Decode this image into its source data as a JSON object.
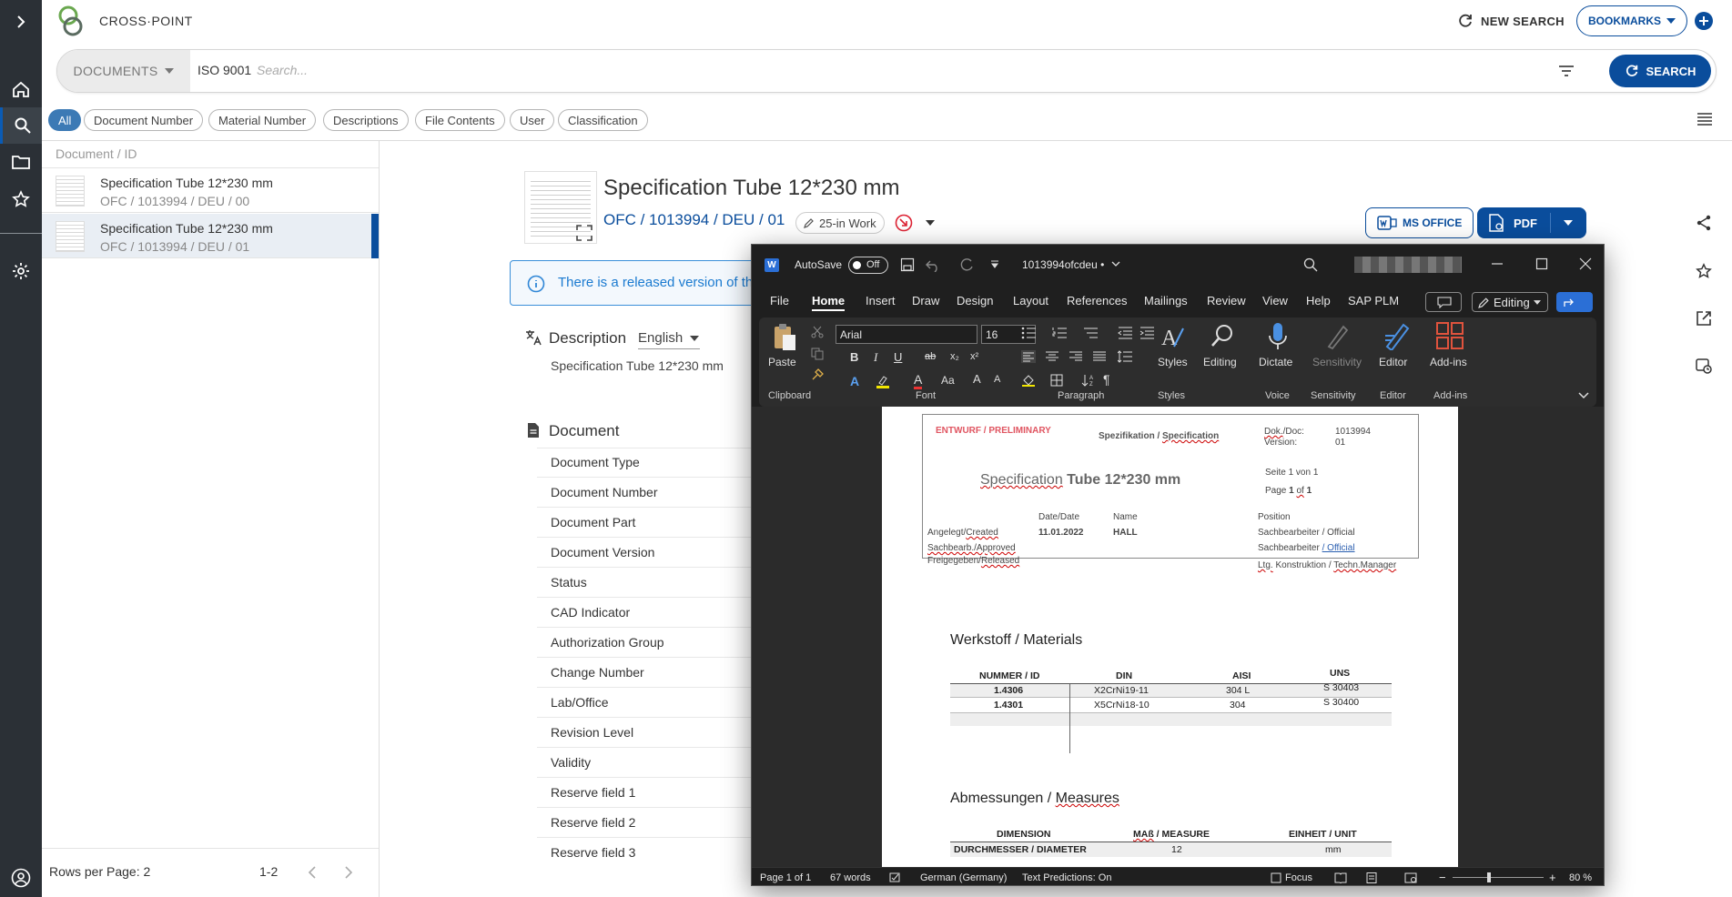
{
  "app": {
    "brand": "CROSS·POINT"
  },
  "header": {
    "new_search": "NEW SEARCH",
    "bookmarks": "BOOKMARKS"
  },
  "search": {
    "doc_type": "DOCUMENTS",
    "query": "ISO 9001",
    "placeholder": "Search...",
    "button": "SEARCH"
  },
  "filters": [
    "All",
    "Document Number",
    "Material Number",
    "Descriptions",
    "File Contents",
    "User",
    "Classification"
  ],
  "list": {
    "header": "Document / ID",
    "rows": [
      {
        "title": "Specification Tube 12*230 mm",
        "sub": "OFC / 1013994 / DEU / 00"
      },
      {
        "title": "Specification Tube 12*230 mm",
        "sub": "OFC / 1013994 / DEU / 01"
      }
    ],
    "rows_per_page": "Rows per Page: 2",
    "range": "1-2"
  },
  "detail": {
    "title": "Specification Tube 12*230 mm",
    "id": "OFC / 1013994 / DEU / 01",
    "status": "25-in Work",
    "ms_office": "MS OFFICE",
    "pdf": "PDF",
    "notice": "There is a released version of this",
    "description_label": "Description",
    "language": "English",
    "description_text": "Specification Tube 12*230 mm",
    "document_label": "Document",
    "properties": [
      "Document Type",
      "Document Number",
      "Document Part",
      "Document Version",
      "Status",
      "CAD Indicator",
      "Authorization Group",
      "Change Number",
      "Lab/Office",
      "Revision Level",
      "Validity",
      "Reserve field 1",
      "Reserve field 2",
      "Reserve field 3"
    ]
  },
  "word": {
    "autosave": "AutoSave",
    "toggle": "Off",
    "filename": "1013994ofcdeu •",
    "menu": [
      "File",
      "Home",
      "Insert",
      "Draw",
      "Design",
      "Layout",
      "References",
      "Mailings",
      "Review",
      "View",
      "Help",
      "SAP PLM"
    ],
    "editing_mode": "Editing",
    "font": "Arial",
    "size": "16",
    "ribbon": {
      "paste": "Paste",
      "styles": "Styles",
      "editing": "Editing",
      "dictate": "Dictate",
      "sensitivity": "Sensitivity",
      "editor": "Editor",
      "addins": "Add-ins"
    },
    "groups": {
      "clipboard": "Clipboard",
      "font": "Font",
      "paragraph": "Paragraph",
      "styles": "Styles",
      "voice": "Voice",
      "sensitivity": "Sensitivity",
      "editor": "Editor",
      "addins": "Add-ins"
    },
    "status": {
      "page": "Page 1 of 1",
      "words": "67 words",
      "lang": "German (Germany)",
      "predictions": "Text Predictions: On",
      "focus": "Focus",
      "zoom": "80 %"
    },
    "doc": {
      "draft": "ENTWURF / PRELIMINARY",
      "spec_a": "Spezifikation / ",
      "spec_b": "Specification",
      "dok_a": "Dok.",
      "dok_b": "/Doc:",
      "dok_no": "1013994",
      "version_label": "Version:",
      "version": "01",
      "seite": "Seite 1 von 1",
      "page_a": "Page ",
      "page_b": "1",
      "page_c": "of",
      "page_d": "1",
      "title_a": "Specification",
      "title_b": " Tube 12*230 mm",
      "date_hdr": "Date/Date",
      "name_hdr": "Name",
      "pos_hdr": "Position",
      "created_a": "Angelegt/",
      "created_b": "Created",
      "created_date": "11.01.2022",
      "created_name": "HALL",
      "created_pos": "Sachbearbeiter / Official",
      "approved": "Sachbearb./Approved",
      "approved_pos_a": "Sachbearbeiter ",
      "approved_pos_b": "/ Official",
      "released_a": "Freigegeben/",
      "released_b": "Released",
      "released_pos_a": "Ltg.",
      "released_pos_b": " Konstruktion / ",
      "released_pos_c": "Techn.Manager",
      "materials_heading": "Werkstoff / Materials",
      "mat_headers": [
        "NUMMER / ID",
        "DIN",
        "AISI",
        "UNS"
      ],
      "mat_rows": [
        [
          "1.4306",
          "X2CrNi19-11",
          "304 L",
          "S 30403"
        ],
        [
          "1.4301",
          "X5CrNi18-10",
          "304",
          "S 30400"
        ]
      ],
      "measures_a": "Abmessungen / ",
      "measures_b": "Measures",
      "meas_h1": "DIMENSION",
      "meas_h2a": "MAß",
      "meas_h2b": " / MEASURE",
      "meas_h3": "EINHEIT / UNIT",
      "meas_row": [
        "DURCHMESSER / DIAMETER",
        "12",
        "mm"
      ]
    }
  }
}
